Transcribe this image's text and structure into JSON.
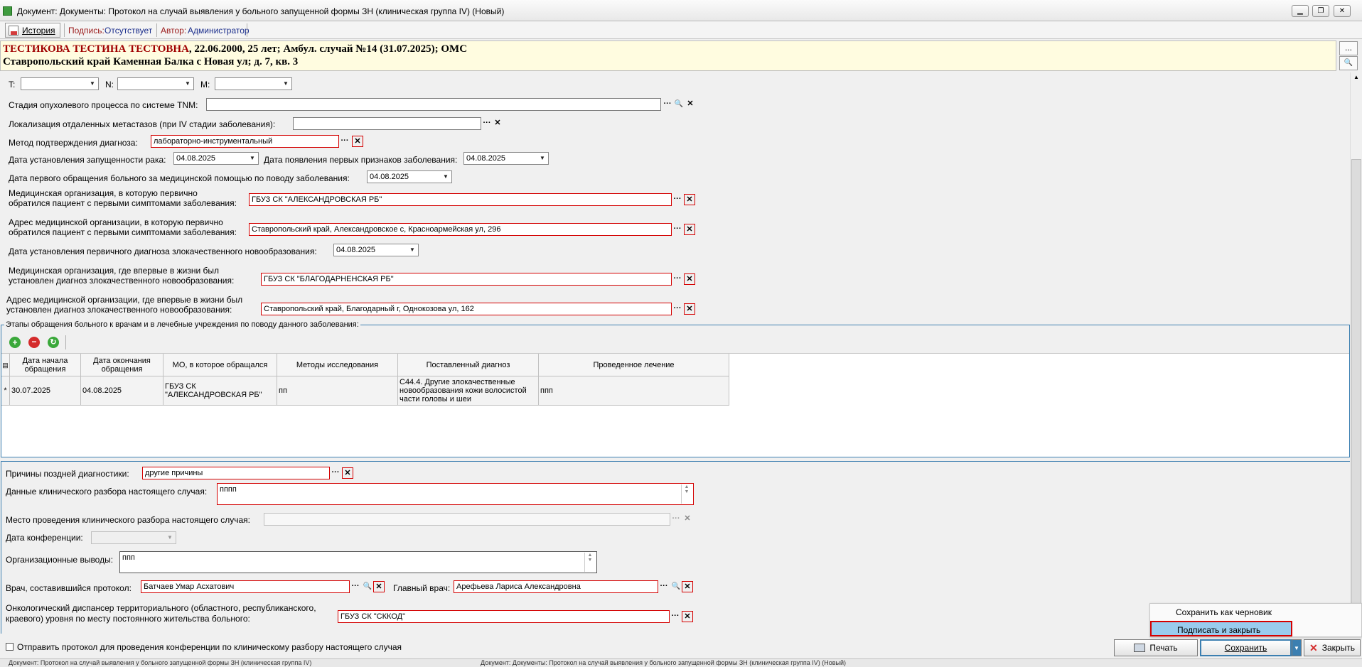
{
  "window": {
    "title": "Документ: Документы: Протокол на случай выявления у больного запущенной формы ЗН (клиническая группа IV) (Новый)",
    "min": "▁",
    "max": "❐",
    "close": "✕"
  },
  "toolbar": {
    "history": "История",
    "sign_label": "Подпись:",
    "sign_value": "Отсутствует",
    "author_label": "Автор:",
    "author_value": "Администратор"
  },
  "header": {
    "line1_name": "ТЕСТИКОВА ТЕСТИНА ТЕСТОВНА",
    "line1_rest": ", 22.06.2000, 25 лет; Амбул. случай №14 (31.07.2025); ОМС",
    "line2": "Ставропольский край Каменная Балка с Новая ул; д. 7, кв. 3",
    "btn_more": "...",
    "btn_search": "🔍"
  },
  "form": {
    "t_label": "T:",
    "n_label": "N:",
    "m_label": "M:",
    "tnm_label": "Стадия опухолевого процесса по системе TNM:",
    "tnm_value": "",
    "metast_label": "Локализация отдаленных метастазов (при IV стадии заболевания):",
    "metast_value": "",
    "method_label": "Метод подтверждения диагноза:",
    "method_value": "лабораторно-инструментальный",
    "neglect_date_label": "Дата установления запущенности рака:",
    "neglect_date": "04.08.2025",
    "first_signs_label": "Дата появления первых признаков заболевания:",
    "first_signs_date": "04.08.2025",
    "first_visit_label": "Дата первого обращения больного за медицинской помощью по поводу заболевания:",
    "first_visit_date": "04.08.2025",
    "mo_first_label1": "Медицинская организация, в которую первично",
    "mo_first_label2": "обратился пациент с первыми симптомами заболевания:",
    "mo_first_value": "ГБУЗ СК \"АЛЕКСАНДРОВСКАЯ РБ\"",
    "addr_first_label1": "Адрес медицинской организации, в которую первично",
    "addr_first_label2": "обратился пациент с первыми симптомами заболевания:",
    "addr_first_value": "Ставропольский край, Александровское с, Красноармейская ул, 296",
    "primary_diag_date_label": "Дата установления первичного диагноза злокачественного новообразования:",
    "primary_diag_date": "04.08.2025",
    "mo_diag_label1": "Медицинская организация, где впервые в жизни был",
    "mo_diag_label2": "установлен диагноз злокачественного новообразования:",
    "mo_diag_value": "ГБУЗ СК \"БЛАГОДАРНЕНСКАЯ РБ\"",
    "addr_diag_label1": "Адрес медицинской организации, где впервые в жизни был",
    "addr_diag_label2": "установлен диагноз злокачественного новообразования:",
    "addr_diag_value": "Ставропольский край, Благодарный г, Однокозова ул, 162"
  },
  "stages": {
    "title": "Этапы обращения больного к врачам и в лечебные учреждения по поводу данного заболевания:",
    "columns": [
      "Дата начала обращения",
      "Дата окончания обращения",
      "МО, в которое обращался",
      "Методы исследования",
      "Поставленный диагноз",
      "Проведенное лечение"
    ],
    "rows": [
      {
        "marker": "*",
        "start": "30.07.2025",
        "end": "04.08.2025",
        "mo": "ГБУЗ СК \"АЛЕКСАНДРОВСКАЯ РБ\"",
        "methods": "пп",
        "diagnosis": "С44.4. Другие злокачественные новообразования кожи волосистой части головы и шеи",
        "treatment": "ппп"
      }
    ]
  },
  "lower": {
    "late_reason_label": "Причины поздней диагностики:",
    "late_reason_value": "другие причины",
    "clinical_label": "Данные клинического разбора настоящего случая:",
    "clinical_value": "пппп",
    "place_label": "Место проведения клинического разбора настоящего случая:",
    "place_value": "",
    "conf_date_label": "Дата конференции:",
    "org_label": "Организационные выводы:",
    "org_value": "ппп",
    "doctor_label": "Врач, составившийся протокол:",
    "doctor_value": "Батчаев Умар Асхатович",
    "chief_label": "Главный врач:",
    "chief_value": "Арефьева Лариса Александровна",
    "dispensary_label1": "Онкологический диспансер территориального (областного, республиканского,",
    "dispensary_label2": "краевого) уровня по месту постоянного жительства больного:",
    "dispensary_value": "ГБУЗ СК \"СККОД\""
  },
  "bottom": {
    "send_label": "Отправить протокол для проведения конференции по клиническому разбору настоящего случая",
    "print": "Печать",
    "save": "Сохранить",
    "close": "Закрыть"
  },
  "menu": {
    "draft": "Сохранить как черновик",
    "sign_close": "Подписать и закрыть"
  },
  "taskbar": {
    "item1": "Документ: Протокол на случай выявления у больного запущенной формы ЗН (клиническая группа IV)",
    "item2": "Документ: Документы: Протокол на случай выявления у больного запущенной формы ЗН (клиническая группа IV) (Новый)"
  },
  "colors": {
    "required_border": "#d40000",
    "accent_blue": "#3c7fb1",
    "header_bg": "#fffce0",
    "menu_highlight": "#99ccee",
    "name_red": "#a00000"
  }
}
